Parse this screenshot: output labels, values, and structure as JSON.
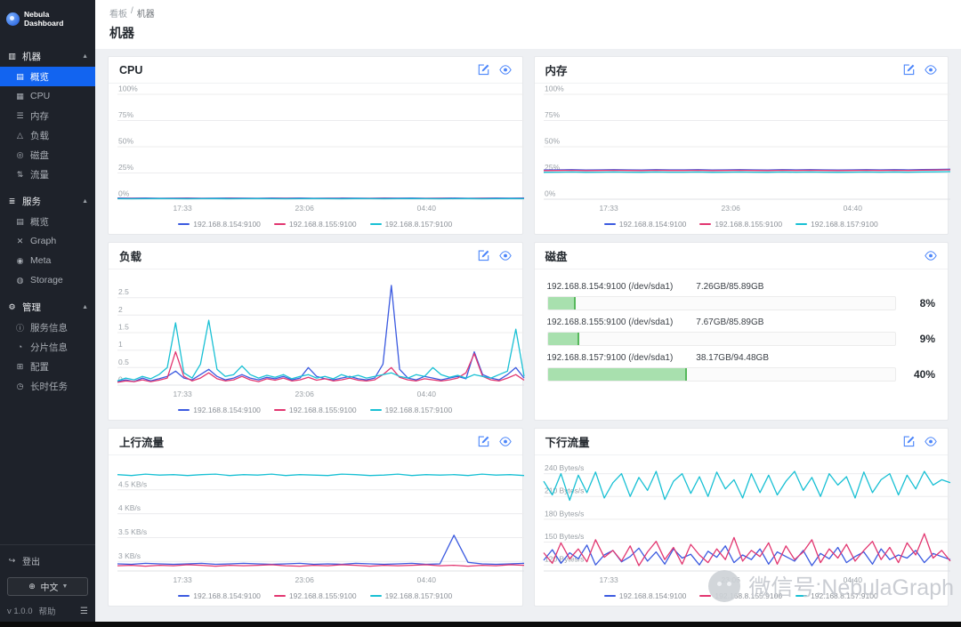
{
  "colors": {
    "accent": "#1264f0",
    "icon_blue": "#4b85fa",
    "disk_fill": "#a8e0ae",
    "disk_edge": "#57b85c"
  },
  "sidebar": {
    "logo": "Nebula Dashboard",
    "sections": [
      {
        "title": "机器",
        "icon": "machine-icon",
        "items": [
          {
            "key": "overview",
            "label": "概览",
            "icon": "overview-icon",
            "active": true
          },
          {
            "key": "cpu",
            "label": "CPU",
            "icon": "cpu-icon"
          },
          {
            "key": "memory",
            "label": "内存",
            "icon": "memory-icon"
          },
          {
            "key": "load",
            "label": "负载",
            "icon": "load-icon"
          },
          {
            "key": "disk",
            "label": "磁盘",
            "icon": "disk-icon"
          },
          {
            "key": "traffic",
            "label": "流量",
            "icon": "traffic-icon"
          }
        ]
      },
      {
        "title": "服务",
        "icon": "service-icon",
        "items": [
          {
            "key": "service-overview",
            "label": "概览",
            "icon": "overview-icon"
          },
          {
            "key": "graph",
            "label": "Graph",
            "icon": "graph-icon"
          },
          {
            "key": "meta",
            "label": "Meta",
            "icon": "meta-icon"
          },
          {
            "key": "storage",
            "label": "Storage",
            "icon": "storage-icon"
          }
        ]
      },
      {
        "title": "管理",
        "icon": "manage-icon",
        "items": [
          {
            "key": "service-info",
            "label": "服务信息",
            "icon": "info-icon"
          },
          {
            "key": "partition-info",
            "label": "分片信息",
            "icon": "partition-icon"
          },
          {
            "key": "config",
            "label": "配置",
            "icon": "config-icon"
          },
          {
            "key": "long-tasks",
            "label": "长时任务",
            "icon": "tasks-icon"
          }
        ]
      }
    ],
    "footer": {
      "logout": "登出",
      "language": "中文",
      "version": "v 1.0.0",
      "help": "帮助"
    }
  },
  "header": {
    "breadcrumb": {
      "home": "看板",
      "separator": "/",
      "current": "机器"
    },
    "title": "机器"
  },
  "watermark": {
    "text": "微信号:NebulaGraph"
  },
  "chart_data": [
    {
      "id": "cpu",
      "type": "line",
      "title": "CPU",
      "ylabel": "%",
      "y_min": 0,
      "y_max": 100,
      "y_ticks": [
        {
          "v": 0,
          "label": "0%"
        },
        {
          "v": 25,
          "label": "25%"
        },
        {
          "v": 50,
          "label": "50%"
        },
        {
          "v": 75,
          "label": "75%"
        },
        {
          "v": 100,
          "label": "100%"
        }
      ],
      "x_ticks": [
        {
          "pos": 0.16,
          "label": "17:33"
        },
        {
          "pos": 0.46,
          "label": "23:06"
        },
        {
          "pos": 0.76,
          "label": "04:40"
        }
      ],
      "series": [
        {
          "name": "192.168.8.154:9100",
          "color": "#3b5ae0",
          "values": [
            1.1,
            1.0,
            1.2,
            0.9,
            1.0,
            1.1,
            0.9,
            1.0,
            1.2,
            1.0,
            0.9,
            1.1,
            1.0,
            1.2,
            0.9,
            1.0,
            1.1,
            1.0,
            0.9,
            1.1,
            1.0,
            1.2,
            0.9,
            1.0,
            1.1,
            0.9,
            1.0,
            1.1,
            1.0,
            1.2
          ]
        },
        {
          "name": "192.168.8.155:9100",
          "color": "#e23670",
          "values": [
            0.7,
            0.8,
            0.6,
            0.7,
            0.8,
            0.7,
            0.6,
            0.8,
            0.7,
            0.6,
            0.7,
            0.8,
            0.7,
            0.6,
            0.7,
            0.8,
            0.6,
            0.7,
            0.8,
            0.7,
            0.6,
            0.7,
            0.8,
            0.7,
            0.6,
            0.8,
            0.7,
            0.6,
            0.7,
            0.8
          ]
        },
        {
          "name": "192.168.8.157:9100",
          "color": "#18c0d4",
          "values": [
            0.5,
            0.4,
            0.5,
            0.6,
            0.5,
            0.4,
            0.5,
            0.6,
            0.4,
            0.5,
            0.6,
            0.5,
            0.4,
            0.5,
            0.6,
            0.5,
            0.4,
            0.6,
            0.5,
            0.4,
            0.5,
            0.6,
            0.5,
            0.4,
            0.5,
            0.6,
            0.4,
            0.5,
            0.6,
            0.5
          ]
        }
      ]
    },
    {
      "id": "memory",
      "type": "line",
      "title": "内存",
      "ylabel": "%",
      "y_min": 0,
      "y_max": 100,
      "y_ticks": [
        {
          "v": 0,
          "label": "0%"
        },
        {
          "v": 25,
          "label": "25%"
        },
        {
          "v": 50,
          "label": "50%"
        },
        {
          "v": 75,
          "label": "75%"
        },
        {
          "v": 100,
          "label": "100%"
        }
      ],
      "x_ticks": [
        {
          "pos": 0.16,
          "label": "17:33"
        },
        {
          "pos": 0.46,
          "label": "23:06"
        },
        {
          "pos": 0.76,
          "label": "04:40"
        }
      ],
      "series": [
        {
          "name": "192.168.8.154:9100",
          "color": "#3b5ae0",
          "values": [
            27.9,
            28.0,
            28.1,
            27.9,
            28.0,
            28.1,
            28.0,
            27.9,
            28.1,
            28.0,
            28.0,
            28.1,
            27.9,
            28.0,
            28.1,
            28.0,
            27.9,
            28.1,
            28.0,
            28.1,
            28.0,
            27.9,
            28.0,
            28.1,
            28.0,
            28.1,
            28.0,
            28.2,
            28.4,
            28.6
          ]
        },
        {
          "name": "192.168.8.155:9100",
          "color": "#e23670",
          "values": [
            27.3,
            27.4,
            27.5,
            27.3,
            27.4,
            27.5,
            27.4,
            27.3,
            27.5,
            27.4,
            27.4,
            27.5,
            27.3,
            27.4,
            27.5,
            27.4,
            27.3,
            27.5,
            27.4,
            27.5,
            27.4,
            27.3,
            27.4,
            27.5,
            27.4,
            27.5,
            27.4,
            27.6,
            27.8,
            28.0
          ]
        },
        {
          "name": "192.168.8.157:9100",
          "color": "#18c0d4",
          "values": [
            25.7,
            25.8,
            25.9,
            25.7,
            25.8,
            25.9,
            25.8,
            25.7,
            25.9,
            25.8,
            25.8,
            25.9,
            25.7,
            25.8,
            25.9,
            25.8,
            25.7,
            25.9,
            25.8,
            25.9,
            25.8,
            25.7,
            25.8,
            25.9,
            25.8,
            25.9,
            25.8,
            26.0,
            26.1,
            26.3
          ]
        }
      ]
    },
    {
      "id": "load",
      "type": "line",
      "title": "负载",
      "ylabel": "",
      "y_min": 0,
      "y_max": 3,
      "y_ticks": [
        {
          "v": 0,
          "label": "0"
        },
        {
          "v": 0.5,
          "label": "0.5"
        },
        {
          "v": 1,
          "label": "1"
        },
        {
          "v": 1.5,
          "label": "1.5"
        },
        {
          "v": 2,
          "label": "2"
        },
        {
          "v": 2.5,
          "label": "2.5"
        }
      ],
      "x_ticks": [
        {
          "pos": 0.16,
          "label": "17:33"
        },
        {
          "pos": 0.46,
          "label": "23:06"
        },
        {
          "pos": 0.76,
          "label": "04:40"
        }
      ],
      "series": [
        {
          "name": "192.168.8.154:9100",
          "color": "#3b5ae0",
          "values": [
            0.1,
            0.15,
            0.1,
            0.2,
            0.12,
            0.18,
            0.25,
            0.4,
            0.2,
            0.15,
            0.3,
            0.45,
            0.25,
            0.15,
            0.2,
            0.3,
            0.2,
            0.15,
            0.22,
            0.18,
            0.25,
            0.15,
            0.2,
            0.5,
            0.25,
            0.18,
            0.15,
            0.2,
            0.25,
            0.18,
            0.15,
            0.2,
            0.6,
            2.85,
            0.45,
            0.2,
            0.15,
            0.25,
            0.2,
            0.15,
            0.2,
            0.25,
            0.18,
            0.95,
            0.3,
            0.2,
            0.15,
            0.3,
            0.5,
            0.2
          ]
        },
        {
          "name": "192.168.8.155:9100",
          "color": "#e23670",
          "values": [
            0.08,
            0.12,
            0.1,
            0.15,
            0.1,
            0.14,
            0.2,
            0.95,
            0.25,
            0.12,
            0.2,
            0.35,
            0.18,
            0.12,
            0.15,
            0.25,
            0.15,
            0.1,
            0.18,
            0.14,
            0.2,
            0.12,
            0.15,
            0.22,
            0.14,
            0.18,
            0.12,
            0.15,
            0.2,
            0.14,
            0.12,
            0.15,
            0.3,
            0.5,
            0.22,
            0.15,
            0.12,
            0.18,
            0.15,
            0.12,
            0.15,
            0.2,
            0.35,
            0.9,
            0.25,
            0.15,
            0.12,
            0.2,
            0.3,
            0.14
          ]
        },
        {
          "name": "192.168.8.157:9100",
          "color": "#18c0d4",
          "values": [
            0.12,
            0.2,
            0.15,
            0.25,
            0.18,
            0.3,
            0.5,
            1.78,
            0.35,
            0.2,
            0.6,
            1.85,
            0.45,
            0.25,
            0.3,
            0.55,
            0.3,
            0.2,
            0.28,
            0.22,
            0.3,
            0.18,
            0.25,
            0.3,
            0.2,
            0.25,
            0.18,
            0.3,
            0.22,
            0.28,
            0.2,
            0.25,
            0.3,
            0.35,
            0.25,
            0.2,
            0.3,
            0.25,
            0.5,
            0.3,
            0.22,
            0.28,
            0.2,
            0.3,
            0.25,
            0.2,
            0.3,
            0.4,
            1.6,
            0.25
          ]
        }
      ]
    },
    {
      "id": "disk",
      "type": "progress",
      "title": "磁盘",
      "rows": [
        {
          "host": "192.168.8.154:9100 (/dev/sda1)",
          "usage": "7.26GB/85.89GB",
          "percent": 8,
          "percent_label": "8%"
        },
        {
          "host": "192.168.8.155:9100 (/dev/sda1)",
          "usage": "7.67GB/85.89GB",
          "percent": 9,
          "percent_label": "9%"
        },
        {
          "host": "192.168.8.157:9100 (/dev/sda1)",
          "usage": "38.17GB/94.48GB",
          "percent": 40,
          "percent_label": "40%"
        }
      ]
    },
    {
      "id": "upload",
      "type": "line",
      "title": "上行流量",
      "ylabel": "KB/s",
      "y_min": 2.8,
      "y_max": 5.0,
      "y_ticks": [
        {
          "v": 3,
          "label": "3 KB/s"
        },
        {
          "v": 3.5,
          "label": "3.5 KB/s"
        },
        {
          "v": 4,
          "label": "4 KB/s"
        },
        {
          "v": 4.5,
          "label": "4.5 KB/s"
        }
      ],
      "x_ticks": [
        {
          "pos": 0.16,
          "label": "17:33"
        },
        {
          "pos": 0.46,
          "label": "23:06"
        },
        {
          "pos": 0.76,
          "label": "04:40"
        }
      ],
      "series": [
        {
          "name": "192.168.8.154:9100",
          "color": "#3b5ae0",
          "values": [
            2.95,
            2.94,
            2.96,
            2.95,
            2.94,
            2.95,
            2.96,
            2.94,
            2.95,
            2.96,
            2.95,
            2.94,
            2.95,
            2.96,
            2.94,
            2.95,
            2.94,
            2.96,
            2.95,
            2.94,
            2.95,
            2.96,
            2.94,
            2.95,
            3.55,
            2.98,
            2.95,
            2.94,
            2.95,
            2.96
          ]
        },
        {
          "name": "192.168.8.155:9100",
          "color": "#e23670",
          "values": [
            2.91,
            2.92,
            2.9,
            2.92,
            2.91,
            2.93,
            2.92,
            2.9,
            2.92,
            2.91,
            2.92,
            2.93,
            2.91,
            2.9,
            2.92,
            2.91,
            2.93,
            2.92,
            2.9,
            2.92,
            2.91,
            2.92,
            2.93,
            2.91,
            2.92,
            2.9,
            2.92,
            2.91,
            2.93,
            2.92
          ]
        },
        {
          "name": "192.168.8.157:9100",
          "color": "#18c0d4",
          "values": [
            4.82,
            4.8,
            4.83,
            4.81,
            4.82,
            4.8,
            4.82,
            4.83,
            4.8,
            4.82,
            4.81,
            4.83,
            4.8,
            4.82,
            4.81,
            4.8,
            4.83,
            4.82,
            4.8,
            4.81,
            4.83,
            4.8,
            4.82,
            4.81,
            4.82,
            4.8,
            4.83,
            4.81,
            4.82,
            4.8
          ]
        }
      ]
    },
    {
      "id": "download",
      "type": "line",
      "title": "下行流量",
      "ylabel": "Bytes/s",
      "y_min": 112,
      "y_max": 250,
      "y_ticks": [
        {
          "v": 120,
          "label": "120 Bytes/s"
        },
        {
          "v": 150,
          "label": "150 Bytes/s"
        },
        {
          "v": 180,
          "label": "180 Bytes/s"
        },
        {
          "v": 210,
          "label": "210 Bytes/s"
        },
        {
          "v": 240,
          "label": "240 Bytes/s"
        }
      ],
      "x_ticks": [
        {
          "pos": 0.16,
          "label": "17:33"
        },
        {
          "pos": 0.46,
          "label": "23:06"
        },
        {
          "pos": 0.76,
          "label": "04:40"
        }
      ],
      "series": [
        {
          "name": "192.168.8.154:9100",
          "color": "#3b5ae0",
          "values": [
            126,
            140,
            122,
            136,
            128,
            146,
            120,
            133,
            139,
            124,
            131,
            142,
            125,
            137,
            121,
            141,
            129,
            134,
            120,
            138,
            130,
            145,
            123,
            133,
            127,
            141,
            121,
            137,
            131,
            125,
            139,
            119,
            135,
            128,
            143,
            123,
            131,
            137,
            121,
            141,
            127,
            133,
            129,
            139,
            123,
            135,
            131,
            127
          ]
        },
        {
          "name": "192.168.8.155:9100",
          "color": "#e23670",
          "values": [
            136,
            122,
            149,
            128,
            141,
            124,
            153,
            130,
            139,
            125,
            145,
            119,
            137,
            151,
            127,
            143,
            121,
            147,
            133,
            123,
            141,
            127,
            156,
            125,
            139,
            131,
            149,
            121,
            145,
            127,
            137,
            153,
            123,
            141,
            129,
            147,
            125,
            139,
            151,
            127,
            143,
            123,
            149,
            133,
            161,
            129,
            139,
            125
          ]
        },
        {
          "name": "192.168.8.157:9100",
          "color": "#18c0d4",
          "values": [
            230,
            212,
            240,
            205,
            238,
            215,
            242,
            208,
            228,
            240,
            210,
            235,
            218,
            243,
            206,
            230,
            240,
            214,
            236,
            210,
            242,
            220,
            232,
            208,
            240,
            215,
            238,
            212,
            230,
            243,
            218,
            235,
            210,
            240,
            225,
            236,
            208,
            242,
            215,
            232,
            240,
            212,
            238,
            220,
            243,
            225,
            232,
            228
          ]
        }
      ]
    }
  ]
}
